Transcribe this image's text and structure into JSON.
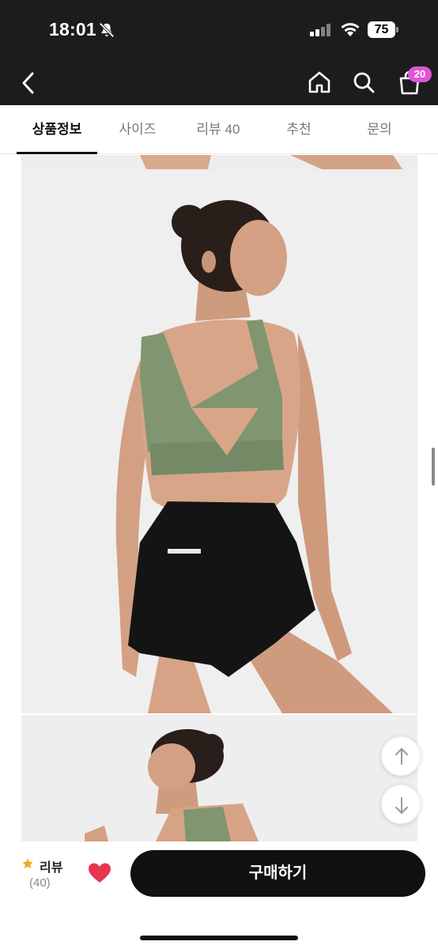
{
  "status_bar": {
    "time": "18:01",
    "battery": "75",
    "muted_icon": "bell-slash-icon"
  },
  "nav": {
    "back_icon": "chevron-left-icon",
    "home_icon": "home-icon",
    "search_icon": "search-icon",
    "cart_icon": "shopping-bag-icon",
    "cart_count": "20",
    "badge_color": "#e055d6"
  },
  "tabs": [
    {
      "label": "상품정보",
      "active": true
    },
    {
      "label": "사이즈",
      "active": false
    },
    {
      "label": "리뷰 40",
      "active": false
    },
    {
      "label": "추천",
      "active": false
    },
    {
      "label": "문의",
      "active": false
    }
  ],
  "content": {
    "images": [
      {
        "name": "product-photo-back-view"
      },
      {
        "name": "product-photo-side-view"
      }
    ]
  },
  "floating": {
    "up_icon": "arrow-up-icon",
    "down_icon": "arrow-down-icon"
  },
  "bottom_bar": {
    "review_label": "리뷰",
    "review_count": "(40)",
    "star_color": "#f5a623",
    "heart_color": "#e8364f",
    "buy_label": "구매하기"
  }
}
